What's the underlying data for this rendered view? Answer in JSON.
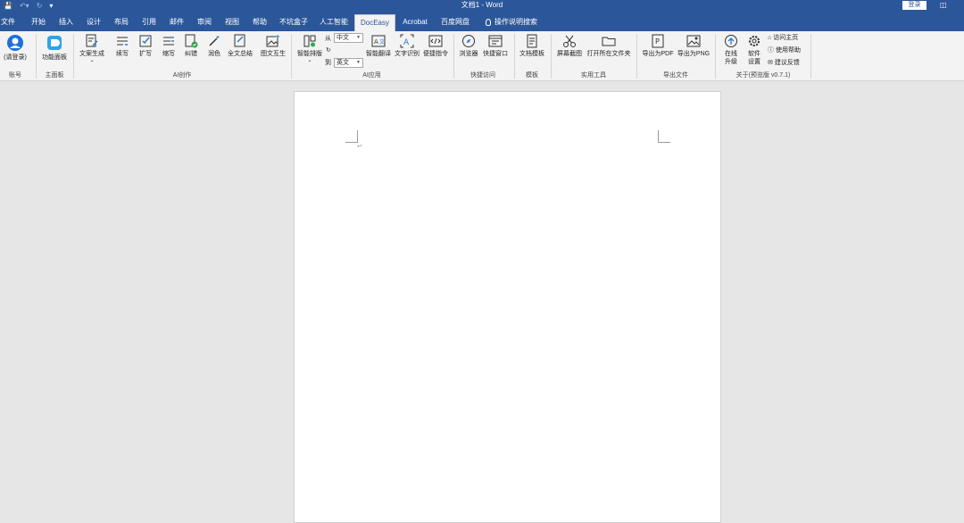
{
  "titlebar": {
    "title": "文档1  -  Word",
    "login_label": "登录",
    "qat_icons": [
      "save-icon",
      "undo-icon",
      "redo-icon",
      "customize-icon"
    ]
  },
  "tabs": {
    "file": "文件",
    "home": "开始",
    "insert": "插入",
    "design": "设计",
    "layout": "布局",
    "references": "引用",
    "mailings": "邮件",
    "review": "审阅",
    "view": "视图",
    "help": "帮助",
    "pitfall_box": "不坑盒子",
    "ai": "人工智能",
    "doceasy": "DocEasy",
    "acrobat": "Acrobat",
    "baidu": "百度网盘",
    "tellme": "操作说明搜索"
  },
  "ribbon": {
    "account": {
      "login_label": "(请登录)",
      "group": "账号"
    },
    "main_panel": {
      "panel_label": "功能面板",
      "group": "主面板"
    },
    "ai_create": {
      "copy_gen": "文案生成",
      "continue": "续写",
      "expand": "扩写",
      "shorten": "缩写",
      "correct": "纠错",
      "polish": "润色",
      "summary": "全文总结",
      "img_text": "图文互生",
      "group": "AI创作"
    },
    "ai_apply": {
      "smart_layout": "智能排版",
      "from_label": "从",
      "to_label": "到",
      "from_lang": "中文",
      "to_lang": "英文",
      "translate": "智能翻译",
      "ocr": "文字识别",
      "commands": "便捷指令",
      "group": "AI应用"
    },
    "quick": {
      "browser": "浏览器",
      "window": "快捷窗口",
      "group": "快捷访问"
    },
    "template": {
      "doc_template": "文档模板",
      "group": "模板"
    },
    "tools": {
      "screenshot": "屏幕截图",
      "open_folder": "打开所在文件夹",
      "group": "实用工具"
    },
    "export": {
      "pdf": "导出为PDF",
      "png": "导出为PNG",
      "group": "导出文件"
    },
    "about": {
      "upgrade_line1": "在线",
      "upgrade_line2": "升级",
      "settings_line1": "软件",
      "settings_line2": "设置",
      "homepage": "访问主页",
      "help": "使用帮助",
      "feedback": "建议反馈",
      "group": "关于(预览版 v0.7.1)"
    }
  },
  "document": {
    "paragraph_mark": "↵"
  }
}
